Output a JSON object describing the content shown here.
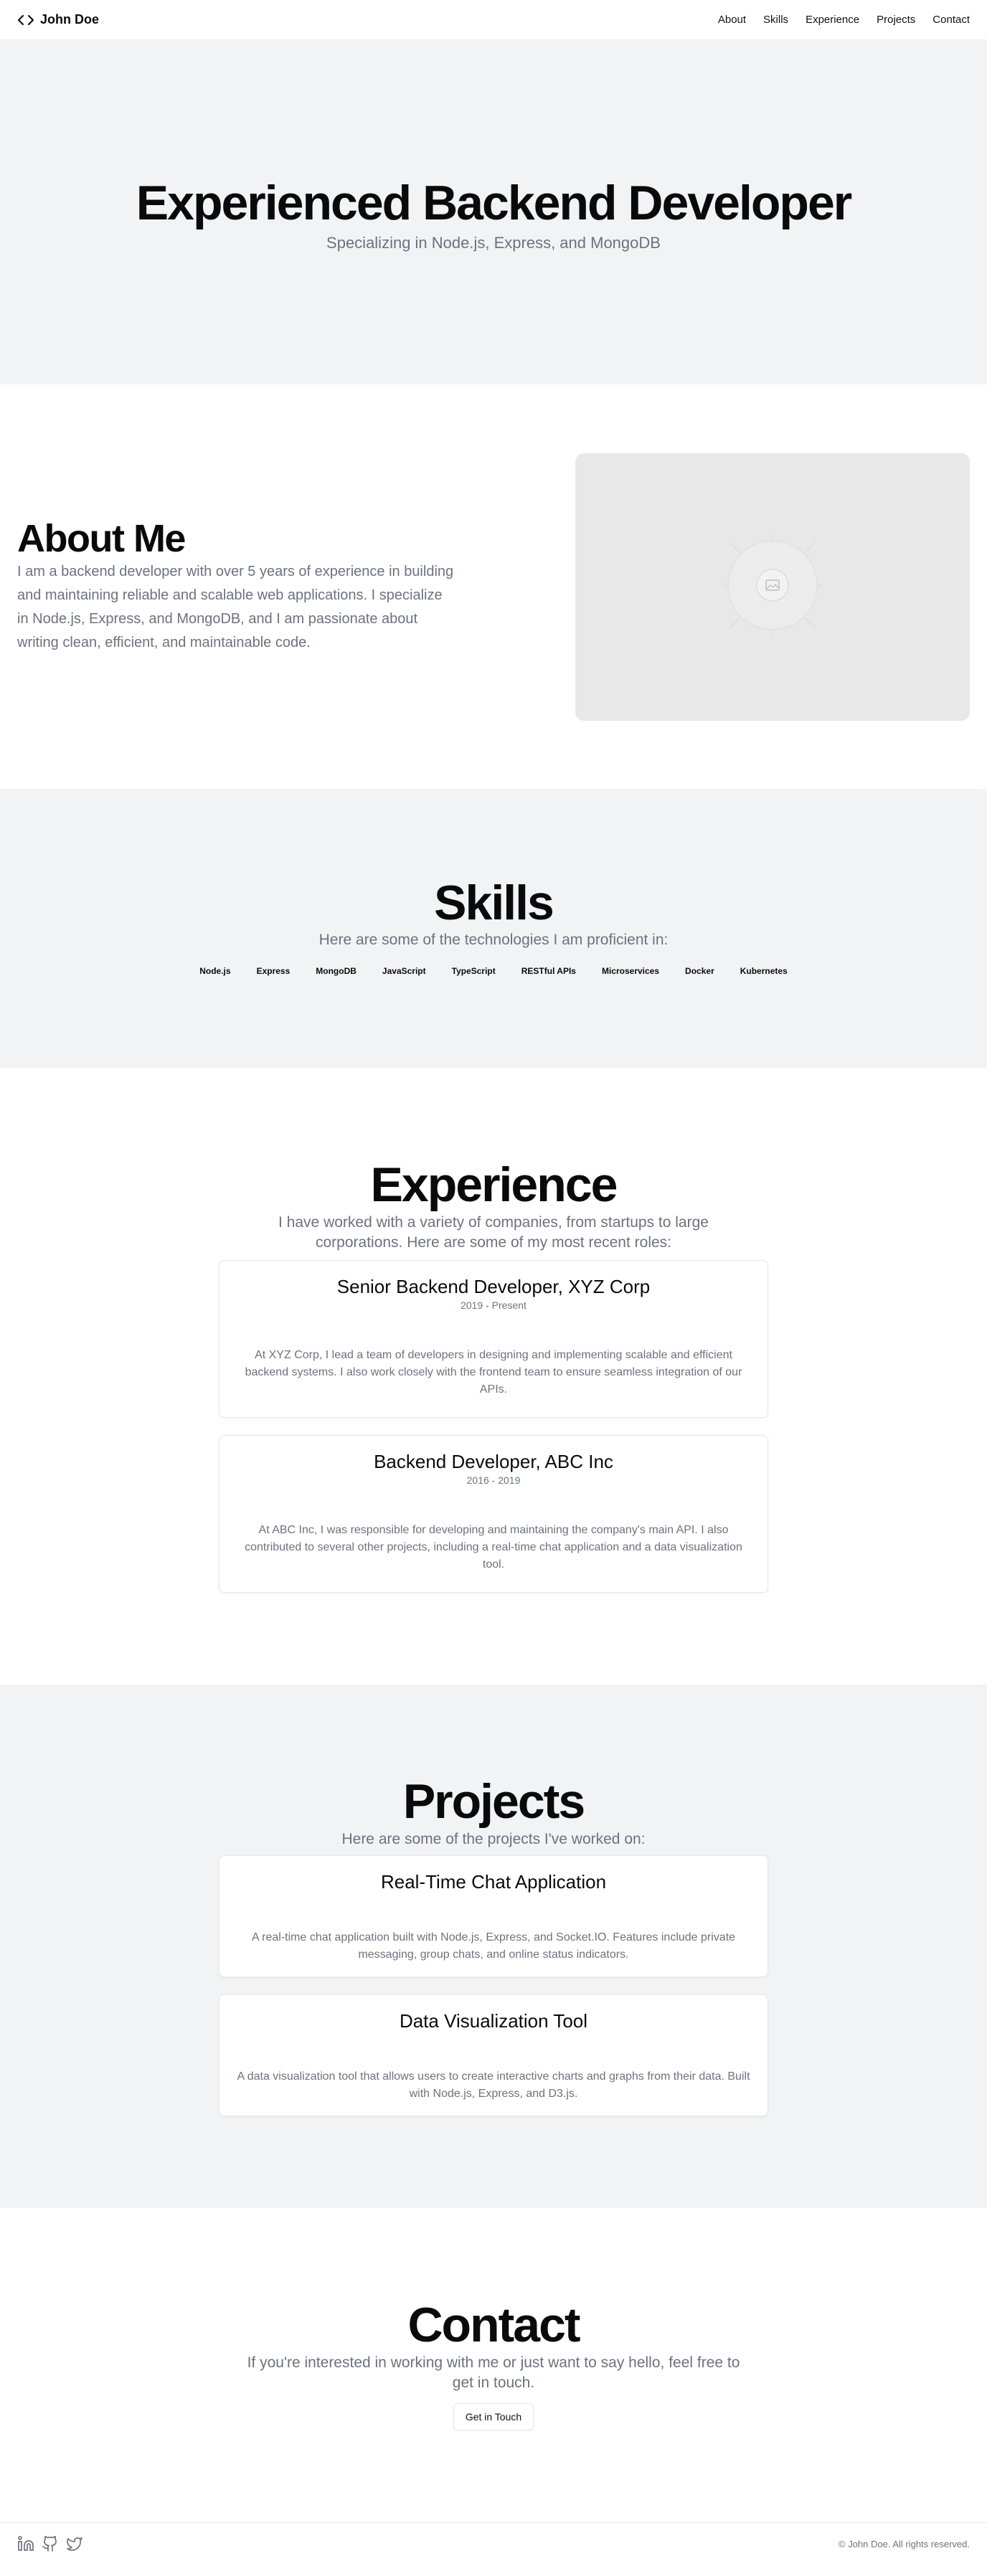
{
  "header": {
    "logo_icon": "code-icon",
    "brand": "John Doe",
    "nav": [
      "About",
      "Skills",
      "Experience",
      "Projects",
      "Contact"
    ]
  },
  "hero": {
    "title": "Experienced Backend Developer",
    "subtitle": "Specializing in Node.js, Express, and MongoDB"
  },
  "about": {
    "title": "About Me",
    "text": "I am a backend developer with over 5 years of experience in building and maintaining reliable and scalable web applications. I specialize in Node.js, Express, and MongoDB, and I am passionate about writing clean, efficient, and maintainable code.",
    "image_icon": "image-placeholder-icon"
  },
  "skills": {
    "title": "Skills",
    "subtitle": "Here are some of the technologies I am proficient in:",
    "items": [
      "Node.js",
      "Express",
      "MongoDB",
      "JavaScript",
      "TypeScript",
      "RESTful APIs",
      "Microservices",
      "Docker",
      "Kubernetes"
    ]
  },
  "experience": {
    "title": "Experience",
    "subtitle": "I have worked with a variety of companies, from startups to large corporations. Here are some of my most recent roles:",
    "jobs": [
      {
        "role": "Senior Backend Developer, XYZ Corp",
        "period": "2019 - Present",
        "description": "At XYZ Corp, I lead a team of developers in designing and implementing scalable and efficient backend systems. I also work closely with the frontend team to ensure seamless integration of our APIs."
      },
      {
        "role": "Backend Developer, ABC Inc",
        "period": "2016 - 2019",
        "description": "At ABC Inc, I was responsible for developing and maintaining the company's main API. I also contributed to several other projects, including a real-time chat application and a data visualization tool."
      }
    ]
  },
  "projects": {
    "title": "Projects",
    "subtitle": "Here are some of the projects I've worked on:",
    "items": [
      {
        "name": "Real-Time Chat Application",
        "description": "A real-time chat application built with Node.js, Express, and Socket.IO. Features include private messaging, group chats, and online status indicators."
      },
      {
        "name": "Data Visualization Tool",
        "description": "A data visualization tool that allows users to create interactive charts and graphs from their data. Built with Node.js, Express, and D3.js."
      }
    ]
  },
  "contact": {
    "title": "Contact",
    "subtitle": "If you're interested in working with me or just want to say hello, feel free to get in touch.",
    "button": "Get in Touch"
  },
  "footer": {
    "social_icons": [
      "linkedin-icon",
      "github-icon",
      "twitter-icon"
    ],
    "copyright": "© John Doe. All rights reserved."
  }
}
